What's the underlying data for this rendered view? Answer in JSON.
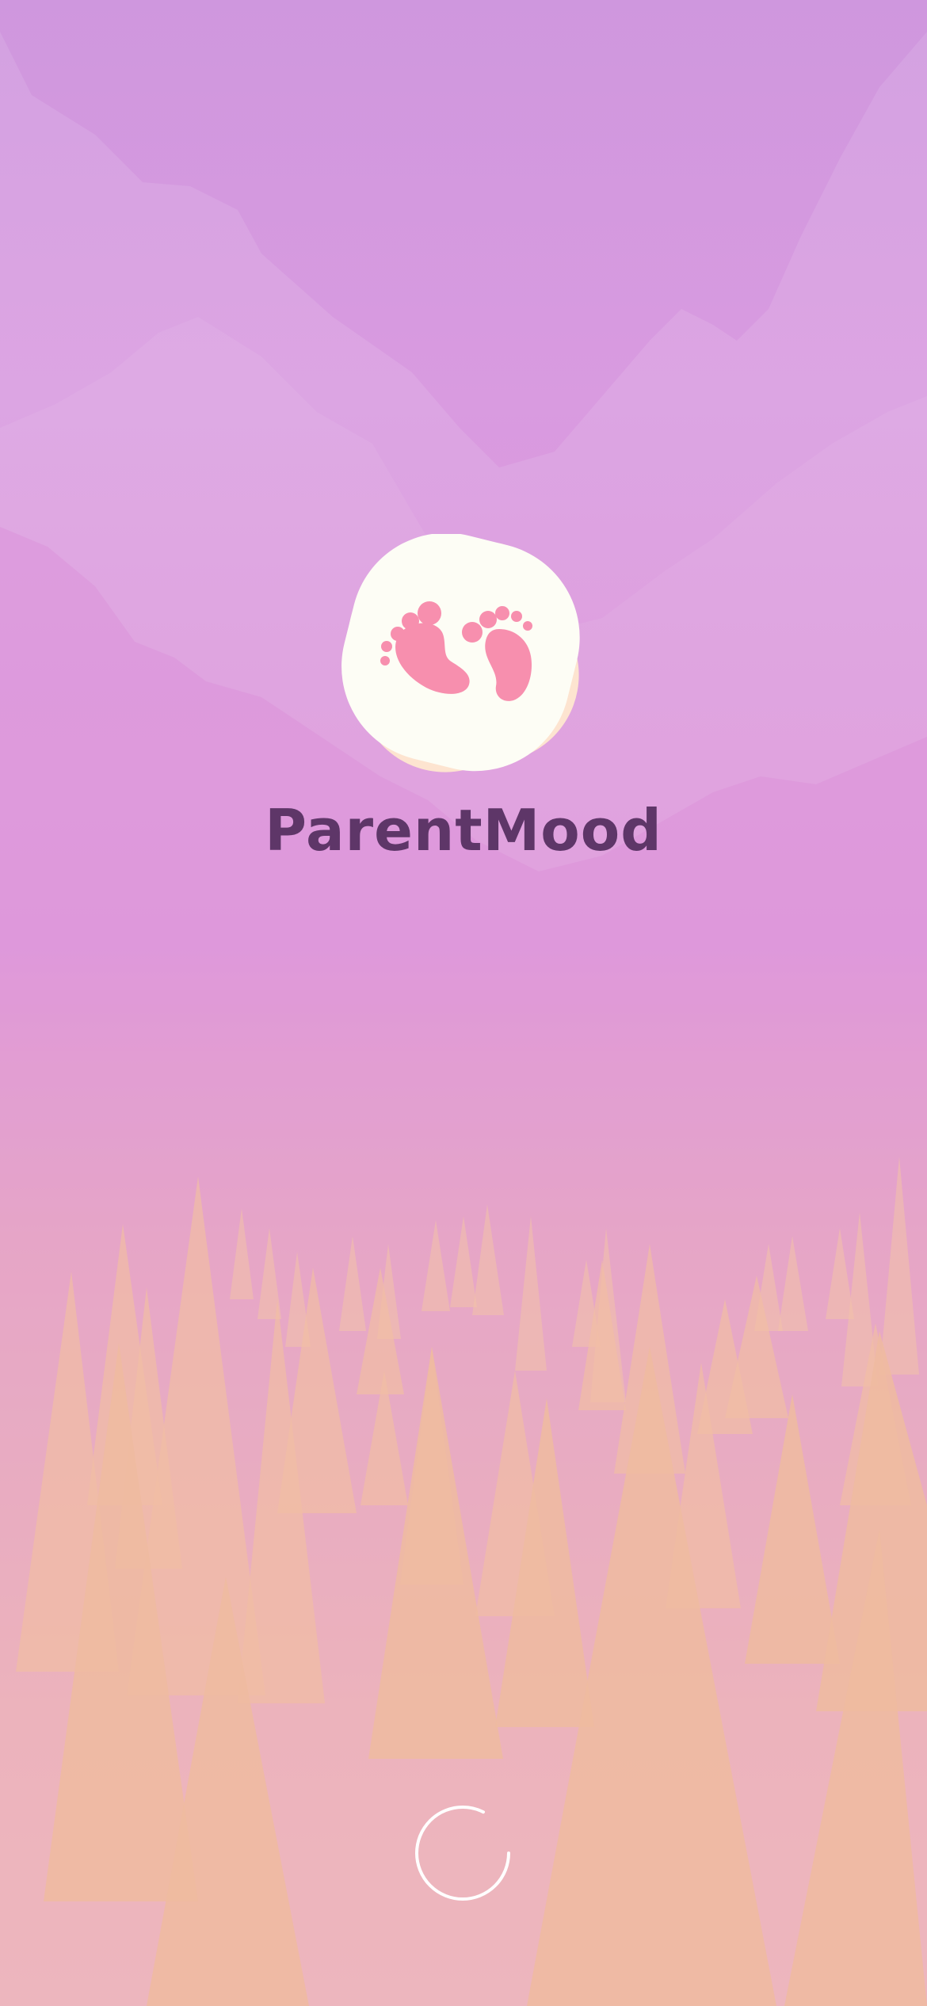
{
  "app": {
    "name": "ParentMood"
  },
  "logo": {
    "icon": "baby-footprints-icon"
  },
  "loading": {
    "icon": "loading-spinner-icon"
  },
  "colors": {
    "title": "#5e3668",
    "footprints": "#f78fae",
    "badge": "#fdfdf5",
    "badge_shadow": "#fde4d0",
    "spinner": "#ffffff"
  }
}
